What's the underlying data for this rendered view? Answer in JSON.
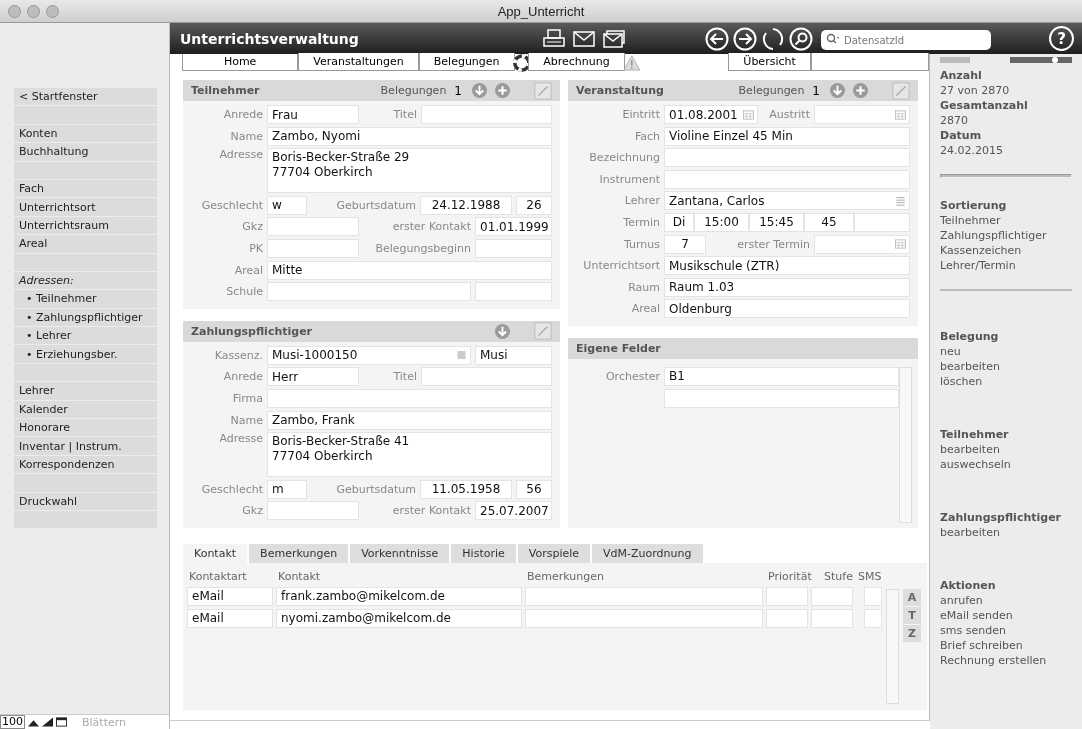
{
  "window": {
    "title": "App_Unterricht"
  },
  "view_toggle": {
    "on": true
  },
  "header": {
    "title": "Unterrichtsverwaltung",
    "search": {
      "placeholder": "DatensatzId"
    },
    "help": "?"
  },
  "nav_tabs": [
    {
      "label": "Home"
    },
    {
      "label": "Veranstaltungen"
    },
    {
      "label": "Belegungen"
    },
    {
      "label": "Abrechnung"
    },
    {
      "label": "Übersicht"
    }
  ],
  "sidebar": {
    "items": [
      {
        "kind": "link",
        "label": "< Startfenster"
      },
      {
        "kind": "blank"
      },
      {
        "kind": "link",
        "label": "Konten"
      },
      {
        "kind": "link",
        "label": "Buchhaltung"
      },
      {
        "kind": "blank"
      },
      {
        "kind": "link",
        "label": "Fach"
      },
      {
        "kind": "link",
        "label": "Unterrichtsort"
      },
      {
        "kind": "link",
        "label": "Unterrichtsraum"
      },
      {
        "kind": "link",
        "label": "Areal"
      },
      {
        "kind": "blank"
      },
      {
        "kind": "heading",
        "label": "Adressen:"
      },
      {
        "kind": "sub",
        "label": "• Teilnehmer"
      },
      {
        "kind": "sub",
        "label": "• Zahlungspflichtiger"
      },
      {
        "kind": "sub",
        "label": "• Lehrer"
      },
      {
        "kind": "sub",
        "label": "• Erziehungsber."
      },
      {
        "kind": "blank"
      },
      {
        "kind": "link",
        "label": "Lehrer"
      },
      {
        "kind": "link",
        "label": "Kalender"
      },
      {
        "kind": "link",
        "label": "Honorare"
      },
      {
        "kind": "link",
        "label": "Inventar | Instrum."
      },
      {
        "kind": "link",
        "label": "Korrespondenzen"
      },
      {
        "kind": "blank"
      },
      {
        "kind": "link",
        "label": "Druckwahl"
      },
      {
        "kind": "blank"
      }
    ]
  },
  "teilnehmer": {
    "title": "Teilnehmer",
    "count_label": "Belegungen",
    "count": "1",
    "rows": [
      {
        "kind": "pair",
        "label": "Anrede",
        "value": "Frau",
        "label2": "Titel"
      },
      {
        "kind": "full",
        "label": "Name",
        "value": "Zambo, Nyomi"
      },
      {
        "kind": "multi",
        "label": "Adresse",
        "lines": [
          "Boris-Becker-Straße 29",
          "77704 Oberkirch"
        ]
      },
      {
        "kind": "birth",
        "label": "Geschlecht",
        "value": "w",
        "label2": "Geburtsdatum",
        "value2": "24.12.1988",
        "value3": "26"
      },
      {
        "kind": "split",
        "label": "Gkz",
        "label2": "erster Kontakt",
        "value2": "01.01.1999"
      },
      {
        "kind": "split",
        "label": "PK",
        "label2": "Belegungsbeginn"
      },
      {
        "kind": "full",
        "label": "Areal",
        "value": "Mitte"
      },
      {
        "kind": "double",
        "label": "Schule"
      }
    ]
  },
  "zahlungspflichtiger": {
    "title": "Zahlungspflichtiger",
    "rows": [
      {
        "kind": "kassenz",
        "label": "Kassenz.",
        "value": "Musi-1000150",
        "value2": "Musi"
      },
      {
        "kind": "pair",
        "label": "Anrede",
        "value": "Herr",
        "label2": "Titel"
      },
      {
        "kind": "full",
        "label": "Firma"
      },
      {
        "kind": "full",
        "label": "Name",
        "value": "Zambo, Frank"
      },
      {
        "kind": "multi",
        "label": "Adresse",
        "lines": [
          "Boris-Becker-Straße 41",
          "77704 Oberkirch"
        ]
      },
      {
        "kind": "birth",
        "label": "Geschlecht",
        "value": "m",
        "label2": "Geburtsdatum",
        "value2": "11.05.1958",
        "value3": "56"
      },
      {
        "kind": "split",
        "label": "Gkz",
        "label2": "erster Kontakt",
        "value2": "25.07.2007"
      }
    ]
  },
  "veranstaltung": {
    "title": "Veranstaltung",
    "count_label": "Belegungen",
    "count": "1",
    "rows": [
      {
        "kind": "dates",
        "label": "Eintritt",
        "value": "01.08.2001",
        "label2": "Austritt"
      },
      {
        "kind": "full",
        "label": "Fach",
        "value": "Violine Einzel 45 Min"
      },
      {
        "kind": "full",
        "label": "Bezeichnung"
      },
      {
        "kind": "full",
        "label": "Instrument"
      },
      {
        "kind": "picker",
        "label": "Lehrer",
        "value": "Zantana, Carlos"
      },
      {
        "kind": "termin",
        "label": "Termin",
        "values": [
          "Di",
          "15:00",
          "15:45",
          "45"
        ]
      },
      {
        "kind": "turnus",
        "label": "Turnus",
        "value": "7",
        "label2": "erster Termin"
      },
      {
        "kind": "full",
        "label": "Unterrichtsort",
        "value": "Musikschule (ZTR)"
      },
      {
        "kind": "full",
        "label": "Raum",
        "value": "Raum 1.03"
      },
      {
        "kind": "full",
        "label": "Areal",
        "value": "Oldenburg"
      }
    ]
  },
  "eigene_felder": {
    "title": "Eigene Felder",
    "rows": [
      {
        "kind": "full",
        "label": "Orchester",
        "value": "B1"
      },
      {
        "kind": "full"
      }
    ]
  },
  "detail_tabs": [
    {
      "label": "Kontakt",
      "selected": true
    },
    {
      "label": "Bemerkungen",
      "selected": false
    },
    {
      "label": "Vorkenntnisse",
      "selected": false
    },
    {
      "label": "Historie",
      "selected": false
    },
    {
      "label": "Vorspiele",
      "selected": false
    },
    {
      "label": "VdM-Zuordnung",
      "selected": false
    }
  ],
  "contacts": {
    "columns": [
      "Kontaktart",
      "Kontakt",
      "Bemerkungen",
      "Priorität",
      "Stufe",
      "SMS"
    ],
    "rows": [
      {
        "kontaktart": "eMail",
        "kontakt": "frank.zambo@mikelcom.de"
      },
      {
        "kontaktart": "eMail",
        "kontakt": "nyomi.zambo@mikelcom.de"
      }
    ],
    "letter_buttons": [
      "A",
      "T",
      "Z"
    ]
  },
  "info_panel": {
    "stats": [
      {
        "label": "Anzahl",
        "value": "27 von 2870"
      },
      {
        "label": "Gesamtanzahl",
        "value": "2870"
      },
      {
        "label": "Datum",
        "value": "24.02.2015"
      }
    ],
    "sections": [
      {
        "title": "Sortierung",
        "links": [
          "Teilnehmer",
          "Zahlungspflichtiger",
          "Kassenzeichen",
          "Lehrer/Termin"
        ],
        "divider_after": true
      },
      {
        "title": "Belegung",
        "links": [
          "neu",
          "bearbeiten",
          "löschen"
        ],
        "divider_after": false
      },
      {
        "title": "Teilnehmer",
        "links": [
          "bearbeiten",
          "auswechseln"
        ],
        "divider_after": false
      },
      {
        "title": "Zahlungspflichtiger",
        "links": [
          "bearbeiten"
        ],
        "divider_after": false
      },
      {
        "title": "Aktionen",
        "links": [
          "anrufen",
          "eMail senden",
          "sms senden",
          "Brief schreiben",
          "Rechnung erstellen"
        ],
        "divider_after": false
      }
    ]
  },
  "status_bar": {
    "zoom": "100",
    "mode": "Blättern"
  }
}
